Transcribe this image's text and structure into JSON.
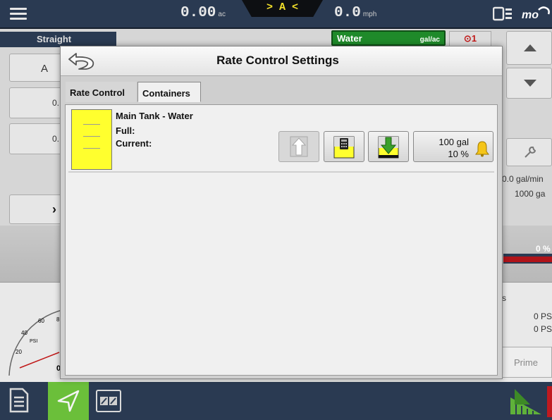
{
  "topbar": {
    "area_value": "0.00",
    "area_unit": "ac",
    "guidance_text": "> A <",
    "speed_value": "0.0",
    "speed_unit": "mph",
    "brand_text": "mo"
  },
  "background": {
    "straight_label": "Straight",
    "water_label": "Water",
    "water_unit": "gal/ac",
    "alert_count": "1",
    "ab_label": "A",
    "value_row_1": "0.",
    "value_row_2": "0.",
    "flow_text": "0.0 gal/min",
    "volume_text": "1000 ga",
    "percent_text": "0 %",
    "s_text": "s",
    "psi_1": "0 PS",
    "psi_2": "0 PS",
    "prime_label": "Prime",
    "gauge_ticks": [
      "20",
      "40",
      "60",
      "8"
    ],
    "gauge_unit": "PSI",
    "gauge_zero": "0"
  },
  "modal": {
    "title": "Rate Control Settings",
    "tabs": [
      {
        "label": "Rate Control",
        "active": false
      },
      {
        "label": "Containers",
        "active": true
      }
    ],
    "container": {
      "name": "Main Tank - Water",
      "full_label": "Full:",
      "current_label": "Current:",
      "level_volume": "100 gal",
      "level_percent": "10 %",
      "buttons": [
        "fill-icon",
        "calculator-icon",
        "empty-icon",
        "bell-icon"
      ]
    }
  },
  "colors": {
    "topbar": "#2a3a52",
    "tank_fill": "#ffff2e",
    "map_active": "#6bbf3a",
    "water_product": "#1f8a2a",
    "guidance_text": "#f2e02a"
  }
}
